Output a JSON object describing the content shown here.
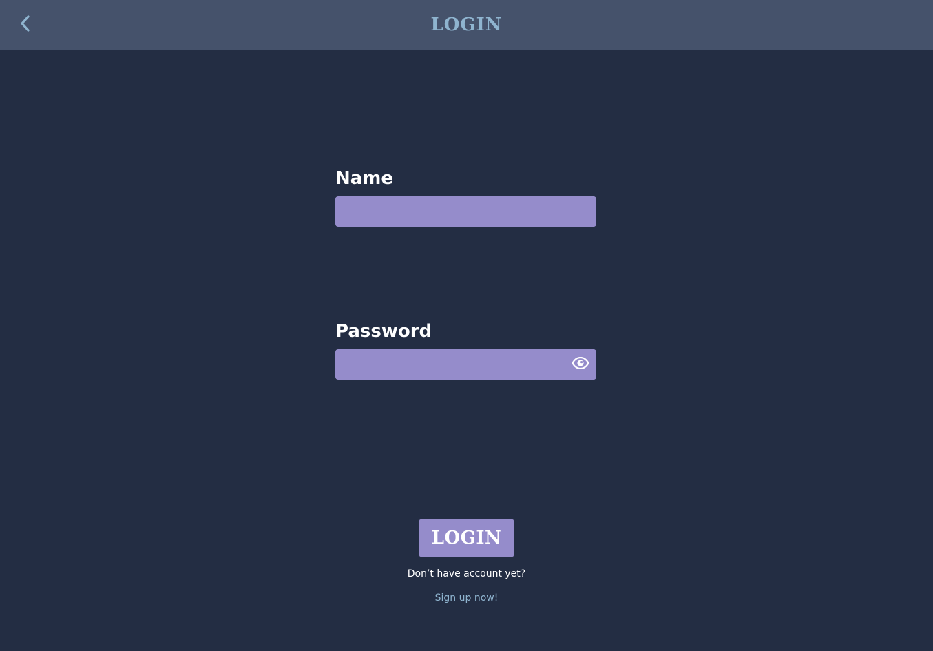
{
  "header": {
    "title": "LOGIN",
    "back_icon": "chevron-left-icon"
  },
  "form": {
    "name_label": "Name",
    "name_value": "",
    "name_placeholder": "",
    "password_label": "Password",
    "password_value": "",
    "password_placeholder": "",
    "password_toggle_icon": "eye-icon",
    "submit_label": "LOGIN"
  },
  "footer": {
    "no_account_text": "Don’t have account yet?",
    "signup_link_text": "Sign up now!"
  },
  "colors": {
    "background": "#232d43",
    "header_background": "#45526b",
    "accent": "#958ccb",
    "title": "#8fb4cf",
    "link": "#8fb4cf",
    "text": "#ffffff"
  }
}
